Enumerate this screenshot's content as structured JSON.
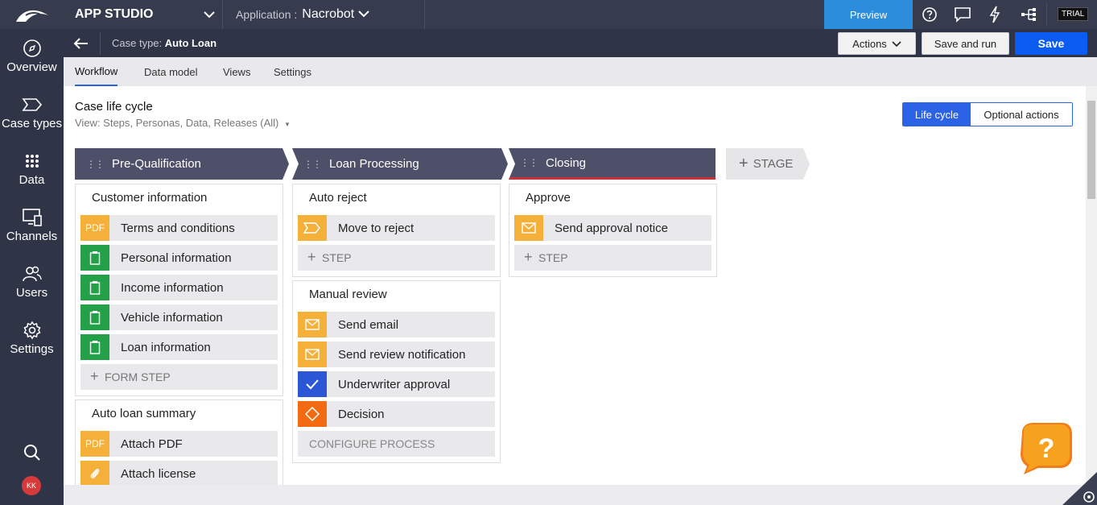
{
  "topbar": {
    "studio_label": "APP STUDIO",
    "application_prefix": "Application :",
    "application_name": "Nacrobot",
    "preview_label": "Preview",
    "trial_label": "TRIAL",
    "icons": [
      "help-icon",
      "chat-icon",
      "lightning-icon",
      "hierarchy-icon"
    ]
  },
  "nav": {
    "items": [
      {
        "label": "Overview",
        "icon": "compass-icon"
      },
      {
        "label": "Case types",
        "icon": "case-types-icon"
      },
      {
        "label": "Data",
        "icon": "data-grid-icon"
      },
      {
        "label": "Channels",
        "icon": "channels-icon"
      },
      {
        "label": "Users",
        "icon": "users-icon"
      },
      {
        "label": "Settings",
        "icon": "gear-icon"
      }
    ],
    "avatar_initials": "KK"
  },
  "casebar": {
    "prefix": "Case type:",
    "name": "Auto Loan",
    "actions_label": "Actions",
    "save_run_label": "Save and run",
    "save_label": "Save"
  },
  "tabs": [
    "Workflow",
    "Data model",
    "Views",
    "Settings"
  ],
  "active_tab": "Workflow",
  "lifecycle": {
    "title": "Case life cycle",
    "view_text": "View: Steps, Personas, Data, Releases (All)",
    "toggle_on": "Life cycle",
    "toggle_off": "Optional actions"
  },
  "stages": [
    {
      "name": "Pre-Qualification"
    },
    {
      "name": "Loan Processing"
    },
    {
      "name": "Closing"
    }
  ],
  "add_stage_label": "STAGE",
  "processes": {
    "customer_information": {
      "title": "Customer information",
      "steps": [
        "Terms and conditions",
        "Personal information",
        "Income information",
        "Vehicle information",
        "Loan information"
      ],
      "add_label": "FORM STEP",
      "pdf_badge": "PDF"
    },
    "auto_loan_summary": {
      "title": "Auto loan summary",
      "steps": [
        "Attach PDF",
        "Attach license"
      ],
      "pdf_badge": "PDF"
    },
    "auto_reject": {
      "title": "Auto reject",
      "steps": [
        "Move to reject"
      ],
      "add_label": "STEP"
    },
    "manual_review": {
      "title": "Manual review",
      "steps": [
        "Send email",
        "Send review notification",
        "Underwriter approval",
        "Decision"
      ],
      "configure_label": "CONFIGURE PROCESS"
    },
    "approve": {
      "title": "Approve",
      "steps": [
        "Send approval notice"
      ],
      "add_label": "STEP"
    }
  },
  "colors": {
    "accent": "#2b62e6",
    "form_green": "#24a148",
    "util_orange": "#f5b03a",
    "approval_blue": "#2b56d6",
    "decision_orange": "#f26b12",
    "stage_dark": "#4d5068",
    "closing_red": "#d02f37"
  }
}
